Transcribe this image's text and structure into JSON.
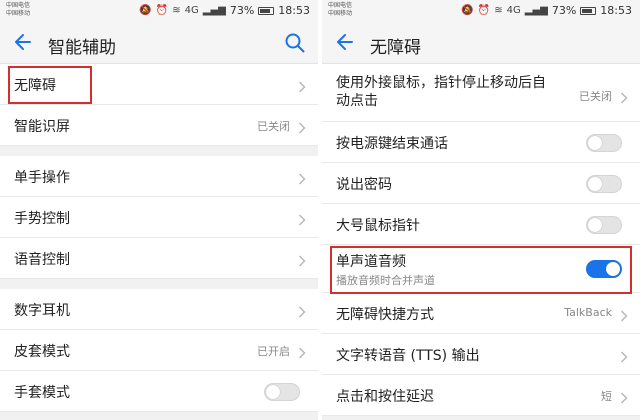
{
  "status": {
    "carrier_line1": "中国电信",
    "carrier_line2": "中国移动",
    "network": "4G",
    "battery": "73%",
    "battery_level": 0.73,
    "time": "18:53"
  },
  "left": {
    "title": "智能辅助",
    "items": [
      {
        "label": "无障碍",
        "value": ""
      },
      {
        "label": "智能识屏",
        "value": "已关闭"
      },
      {
        "label": "单手操作",
        "value": ""
      },
      {
        "label": "手势控制",
        "value": ""
      },
      {
        "label": "语音控制",
        "value": ""
      },
      {
        "label": "数字耳机",
        "value": ""
      },
      {
        "label": "皮套模式",
        "value": "已开启"
      },
      {
        "label": "手套模式",
        "value": ""
      }
    ]
  },
  "right": {
    "title": "无障碍",
    "items": [
      {
        "label_line1": "使用外接鼠标，指针停止移动后自",
        "label_line2": "动点击",
        "value": "已关闭"
      },
      {
        "label": "按电源键结束通话",
        "toggle": false
      },
      {
        "label": "说出密码",
        "toggle": false
      },
      {
        "label": "大号鼠标指针",
        "toggle": false
      },
      {
        "label": "单声道音频",
        "sub": "播放音频时合并声道",
        "toggle": true
      },
      {
        "label": "无障碍快捷方式",
        "value": "TalkBack"
      },
      {
        "label": "文字转语音 (TTS) 输出",
        "value": ""
      },
      {
        "label": "点击和按住延迟",
        "value": "短"
      }
    ]
  },
  "colors": {
    "accent": "#1a73e8",
    "highlight": "#d32f2f"
  }
}
